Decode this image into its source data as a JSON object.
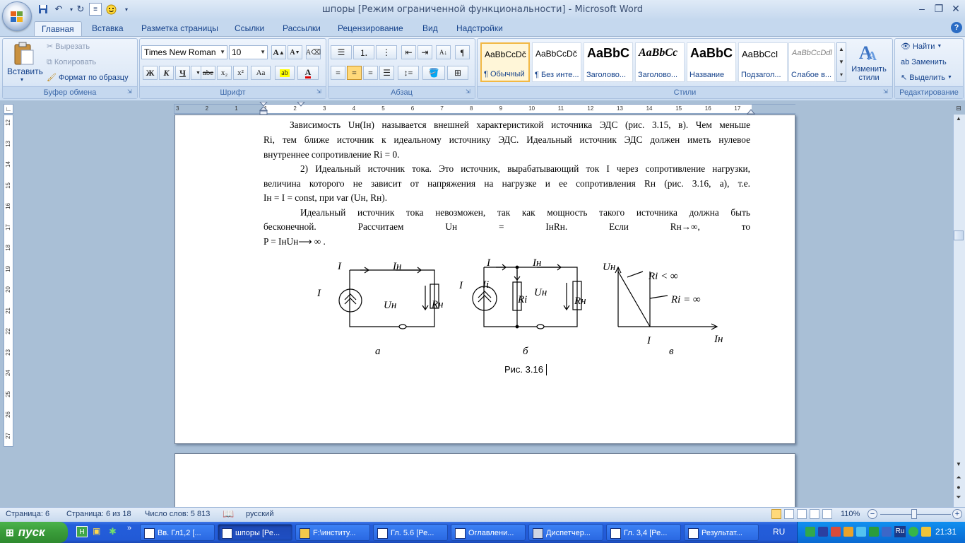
{
  "window": {
    "title": "шпоры [Режим ограниченной функциональности] - Microsoft Word",
    "controls": {
      "minimize": "–",
      "restore": "❐",
      "close": "✕"
    }
  },
  "quick_access": {
    "save_icon": "💾",
    "undo_icon": "↶",
    "redo_icon": "↻"
  },
  "tabs": [
    "Главная",
    "Вставка",
    "Разметка страницы",
    "Ссылки",
    "Рассылки",
    "Рецензирование",
    "Вид",
    "Надстройки"
  ],
  "ribbon": {
    "clipboard": {
      "label": "Буфер обмена",
      "paste": "Вставить",
      "cut": "Вырезать",
      "copy": "Копировать",
      "format_painter": "Формат по образцу"
    },
    "font": {
      "label": "Шрифт",
      "font_name": "Times New Roman",
      "font_size": "10",
      "bold": "Ж",
      "italic": "К",
      "underline": "Ч",
      "strike": "abe",
      "subscript": "x₂",
      "superscript": "x²",
      "change_case": "Aa",
      "grow": "A",
      "shrink": "A"
    },
    "paragraph": {
      "label": "Абзац"
    },
    "styles": {
      "label": "Стили",
      "items": [
        {
          "preview": "AaBbCcDč",
          "name": "¶ Обычный"
        },
        {
          "preview": "AaBbCcDč",
          "name": "¶ Без инте..."
        },
        {
          "preview": "AaBbC",
          "name": "Заголово..."
        },
        {
          "preview": "AaBbCc",
          "name": "Заголово..."
        },
        {
          "preview": "AaBbC",
          "name": "Название"
        },
        {
          "preview": "AaBbCcI",
          "name": "Подзагол..."
        },
        {
          "preview": "AaBbCcDdl",
          "name": "Слабое в..."
        }
      ],
      "change_styles": "Изменить стили"
    },
    "editing": {
      "label": "Редактирование",
      "find": "Найти",
      "replace": "Заменить",
      "select": "Выделить"
    }
  },
  "document": {
    "lines": [
      "Зависимость Uн(Iн) называется внешней характеристикой источника ЭДС (рис. 3.15, в). Чем меньше",
      "Ri, тем ближе источник к идеальному источнику ЭДС. Идеальный источник ЭДС должен иметь нулевое",
      "внутреннее сопротивление Ri = 0.",
      "2) Идеальный источник тока. Это источник, вырабатывающий ток I через сопротивление нагрузки,",
      "величина которого не зависит от напряжения на нагрузке и ее сопротивления Rн (рис. 3.16, а), т.е.",
      "Iн = I = const, при var (Uн, Rн).",
      "Идеальный источник тока невозможен, так как мощность такого источника должна быть",
      "бесконечной. Рассчитаем Uн = IнRн. Если Rн→∞, то",
      "P = IнUн⟶ ∞ ."
    ],
    "figure": {
      "caption": "Рис. 3.16",
      "sub_a": "а",
      "sub_b": "б",
      "sub_c": "в",
      "labels": {
        "I": "I",
        "In": "Iн",
        "Un": "Uн",
        "Rn": "Rн",
        "Ri": "Ri",
        "Ii": "Ii",
        "ri_lt_inf": "Ri < ∞",
        "ri_eq_inf": "Ri = ∞"
      }
    }
  },
  "ruler": {
    "h_ticks": [
      "3",
      "2",
      "1",
      "1",
      "2",
      "3",
      "4",
      "5",
      "6",
      "7",
      "8",
      "9",
      "10",
      "11",
      "12",
      "13",
      "14",
      "15",
      "16",
      "17"
    ],
    "v_ticks": [
      "12",
      "13",
      "14",
      "15",
      "16",
      "17",
      "18",
      "19",
      "20",
      "21",
      "22",
      "23",
      "24",
      "25",
      "26",
      "27"
    ]
  },
  "status": {
    "page": "Страница: 6",
    "pages": "Страница: 6 из 18",
    "words": "Число слов: 5 813",
    "language": "русский",
    "zoom": "110%"
  },
  "taskbar": {
    "start": "пуск",
    "tasks": [
      "Вв. Гл1,2 [...",
      "шпоры [Ре...",
      "F:\\институ...",
      "Гл. 5.6 [Ре...",
      "Оглавлени...",
      "Диспетчер...",
      "Гл. 3,4 [Ре...",
      "Результат..."
    ],
    "lang": "RU",
    "tray_lang": "Ru",
    "clock": "21:31"
  }
}
